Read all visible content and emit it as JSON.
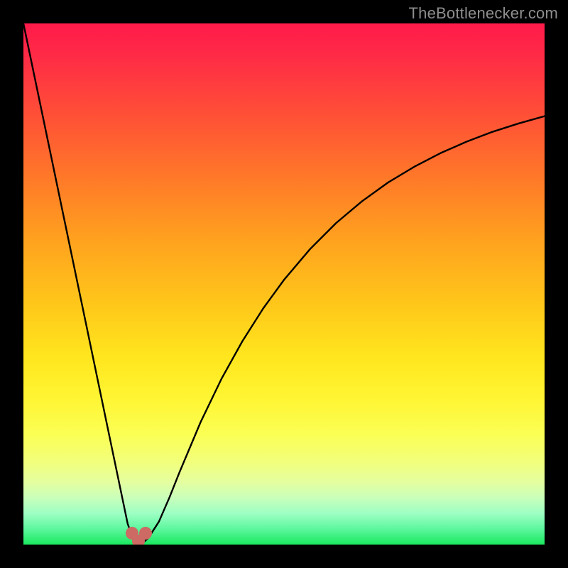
{
  "watermark": "TheBottlenecker.com",
  "chart_data": {
    "type": "line",
    "title": "",
    "xlabel": "",
    "ylabel": "",
    "xlim": [
      0,
      100
    ],
    "ylim": [
      0,
      100
    ],
    "grid": false,
    "background": "rainbow_gradient_vertical_red_top_green_bottom",
    "series": [
      {
        "name": "bottleneck-curve",
        "x": [
          0,
          2,
          4,
          6,
          8,
          10,
          12,
          14,
          15,
          16,
          17,
          18,
          19,
          20,
          21,
          22,
          23,
          24,
          26,
          28,
          30,
          34,
          38,
          42,
          46,
          50,
          55,
          60,
          65,
          70,
          75,
          80,
          85,
          90,
          95,
          100
        ],
        "y": [
          100,
          90.4,
          80.8,
          71.2,
          61.6,
          52.0,
          42.4,
          32.8,
          28.0,
          23.2,
          18.4,
          13.6,
          8.8,
          4.0,
          1.2,
          0.4,
          0.4,
          1.3,
          4.4,
          9.0,
          14.0,
          23.5,
          31.8,
          39.0,
          45.3,
          50.8,
          56.7,
          61.7,
          65.9,
          69.5,
          72.5,
          75.1,
          77.3,
          79.2,
          80.8,
          82.2
        ]
      }
    ],
    "markers": [
      {
        "name": "marker-left",
        "x": 20.8,
        "y": 2.2,
        "color": "#cc6a63",
        "size": 18
      },
      {
        "name": "marker-right",
        "x": 23.4,
        "y": 2.2,
        "color": "#cc6a63",
        "size": 18
      },
      {
        "name": "marker-bottom",
        "x": 22.0,
        "y": 0.7,
        "color": "#cc6a63",
        "size": 18
      }
    ],
    "notes": "Black frame with inset plotting area. Curve shows steep V dip near x≈22 then asymptotic rise. Values read approximately from pixel positions; no axis tick labels visible."
  }
}
